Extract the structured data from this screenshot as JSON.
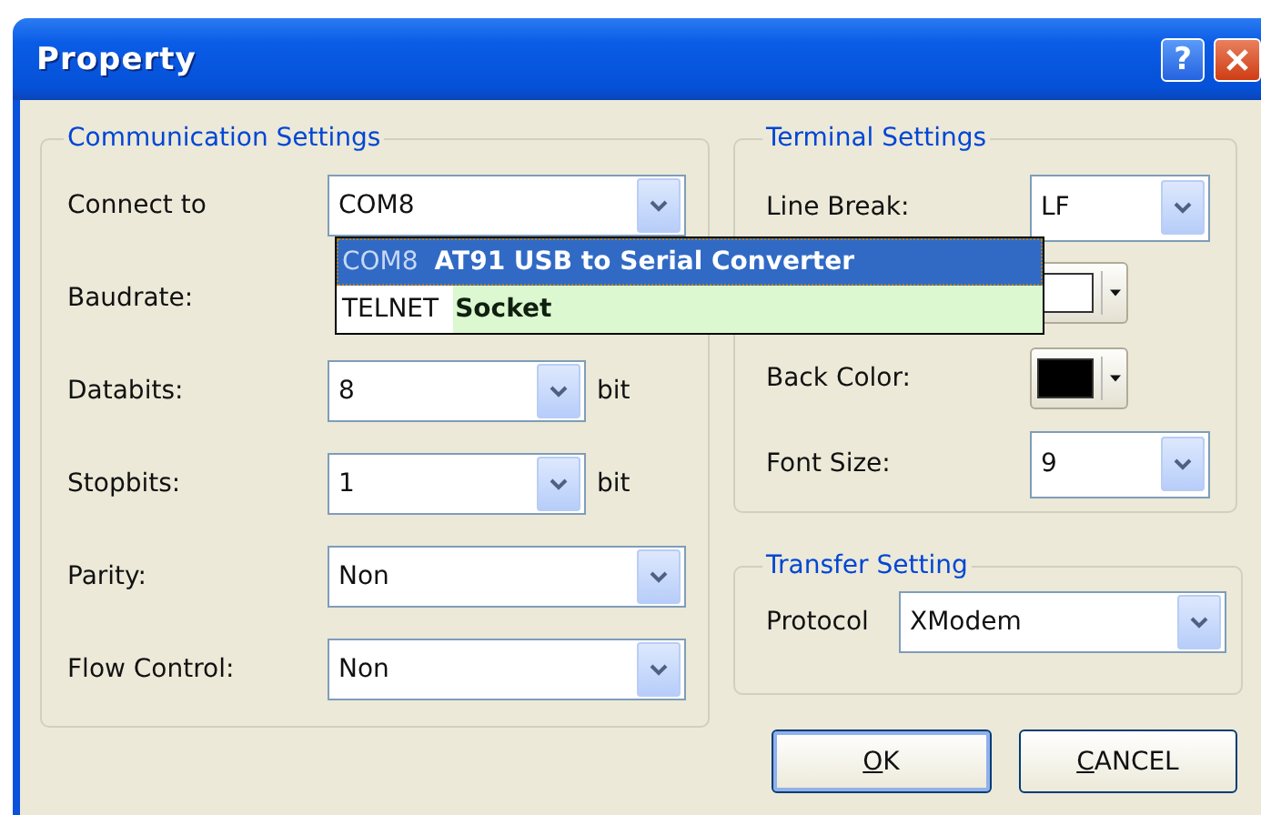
{
  "window": {
    "title": "Property",
    "help_button": "?"
  },
  "communication_settings": {
    "title": "Communication Settings",
    "rows": [
      {
        "label": "Connect to",
        "value": "COM8"
      },
      {
        "label": "Baudrate:"
      },
      {
        "label": "Databits:",
        "value": "8",
        "unit": "bit"
      },
      {
        "label": "Stopbits:",
        "value": "1",
        "unit": "bit"
      },
      {
        "label": "Parity:",
        "value": "Non"
      },
      {
        "label": "Flow Control:",
        "value": "Non"
      }
    ],
    "dropdown": [
      {
        "port": "COM8",
        "description": "AT91 USB to Serial Converter",
        "selected": true
      },
      {
        "port": "TELNET",
        "description": "Socket",
        "selected": false
      }
    ]
  },
  "terminal_settings": {
    "title": "Terminal Settings",
    "rows": [
      {
        "kind": "combo",
        "label": "Line Break:",
        "value": "LF"
      },
      {
        "kind": "color",
        "color": "#ffffff"
      },
      {
        "kind": "color",
        "label": "Back Color:",
        "color": "#000000"
      },
      {
        "kind": "combo",
        "label": "Font Size:",
        "value": "9"
      }
    ]
  },
  "transfer_setting": {
    "title": "Transfer Setting",
    "label": "Protocol",
    "value": "XModem"
  },
  "buttons": [
    {
      "label": "OK",
      "default": true
    },
    {
      "label": "CANCEL",
      "default": false
    }
  ]
}
